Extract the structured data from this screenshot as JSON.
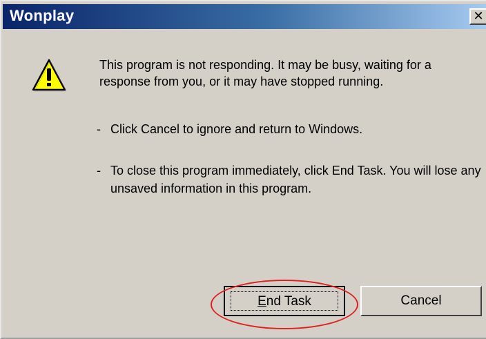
{
  "window": {
    "title": "Wonplay",
    "close_symbol": "✕"
  },
  "dialog": {
    "icon": "warning-icon",
    "message": "This program is not responding. It may be busy, waiting for a response from you, or it may have stopped running.",
    "bullets": [
      {
        "dash": "-",
        "text": "Click Cancel to ignore and return to Windows."
      },
      {
        "dash": "-",
        "text": "To close this program immediately, click End Task. You will lose any unsaved information in this program."
      }
    ]
  },
  "buttons": {
    "end_task": {
      "mnemonic": "E",
      "rest": "nd Task",
      "label": "End Task"
    },
    "cancel": {
      "label": "Cancel"
    }
  },
  "colors": {
    "title_bar_start": "#0a246a",
    "title_bar_end": "#a6caf0",
    "dialog_face": "#d4d0c8",
    "annotation_ellipse": "#e02020",
    "warning_fill": "#ffff00"
  }
}
